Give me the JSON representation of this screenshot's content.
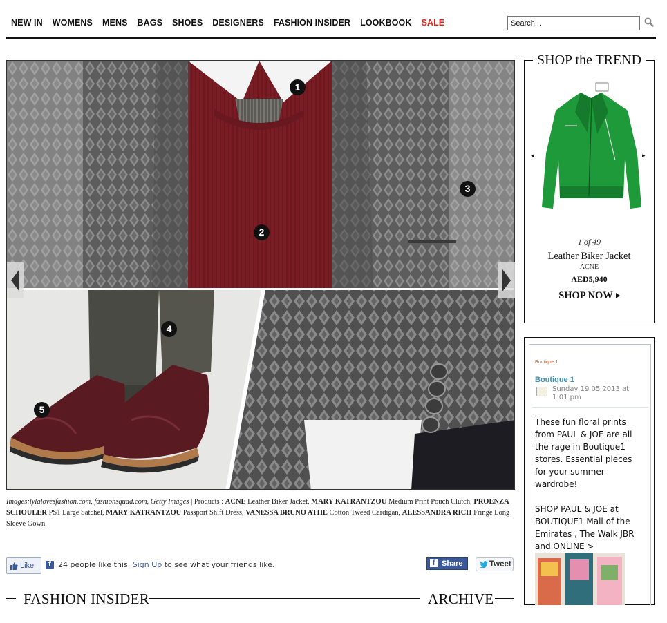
{
  "nav": {
    "items": [
      {
        "label": "NEW IN"
      },
      {
        "label": "WOMENS"
      },
      {
        "label": "MENS"
      },
      {
        "label": "BAGS"
      },
      {
        "label": "SHOES"
      },
      {
        "label": "DESIGNERS"
      },
      {
        "label": "FASHION INSIDER"
      },
      {
        "label": "LOOKBOOK"
      },
      {
        "label": "SALE"
      }
    ],
    "sale_color": "#e0271b",
    "search_placeholder": "Search..."
  },
  "hero": {
    "markers": [
      "1",
      "2",
      "3",
      "4",
      "5"
    ],
    "credits": {
      "images_label": "Images:lylalovesfashion.com, fashionsquad.com, Getty Images",
      "products_label": " | Products : ",
      "items": [
        {
          "brand": "ACNE",
          "product": " Leather Biker Jacket, "
        },
        {
          "brand": "MARY KATRANTZOU",
          "product": " Medium Print Pouch Clutch, "
        },
        {
          "brand": "PROENZA SCHOULER",
          "product": " PS1 Large Satchel, "
        },
        {
          "brand": "MARY KATRANTZOU",
          "product": " Passport Shift Dress, "
        },
        {
          "brand": "VANESSA BRUNO ATHE",
          "product": " Cotton Tweed Cardigan, "
        },
        {
          "brand": "ALESSANDRA RICH",
          "product": " Fringe Long Sleeve Gown"
        }
      ]
    }
  },
  "social": {
    "like_label": "Like",
    "like_count_text": "24 people like this.",
    "signup_label": "Sign Up",
    "signup_suffix": " to see what your friends like.",
    "share_label": "Share",
    "tweet_label": "Tweet"
  },
  "sections": {
    "fashion_insider": "FASHION INSIDER",
    "archive": "ARCHIVE"
  },
  "trend": {
    "title": "SHOP the TREND",
    "count": "1 of 49",
    "product_name": "Leather Biker Jacket",
    "brand": "ACNE",
    "price": "AED5,940",
    "cta": "SHOP NOW",
    "prev_icon": "◂",
    "next_icon": "▸",
    "product_color": "#1f9a3b"
  },
  "fb_feed": {
    "page_small": "Boutique 1",
    "page_name": "Boutique 1",
    "date": "Sunday 19 05 2013 at 1:01 pm",
    "post_text": "These fun floral prints from PAUL & JOE are all the rage in Boutique1 stores. Essential pieces for your summer wardrobe!\n\nSHOP PAUL & JOE at BOUTIQUE1 Mall of the Emirates , The Walk JBR and ONLINE > http://goo.gl/xpTkN"
  }
}
